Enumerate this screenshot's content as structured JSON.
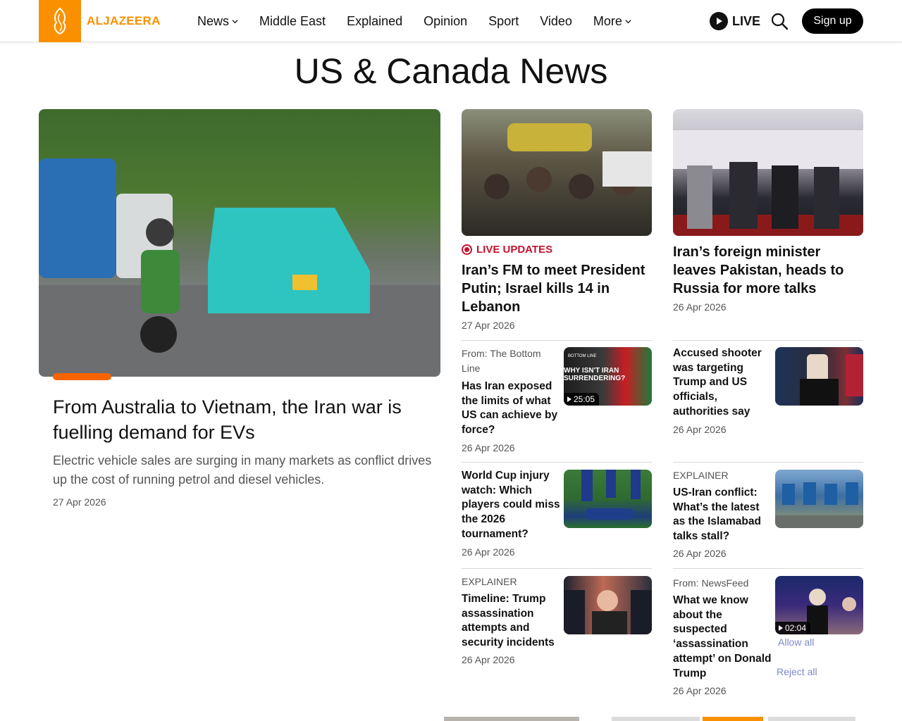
{
  "brand": {
    "logo_text": "ALJAZEERA",
    "accent_color": "#fa9000",
    "live_color": "#c4122f"
  },
  "nav": {
    "items": [
      {
        "label": "News",
        "has_dropdown": true
      },
      {
        "label": "Middle East",
        "has_dropdown": false
      },
      {
        "label": "Explained",
        "has_dropdown": false
      },
      {
        "label": "Opinion",
        "has_dropdown": false
      },
      {
        "label": "Sport",
        "has_dropdown": false
      },
      {
        "label": "Video",
        "has_dropdown": false
      },
      {
        "label": "More",
        "has_dropdown": true
      }
    ],
    "live_label": "LIVE",
    "signup_label": "Sign up"
  },
  "page": {
    "title": "US & Canada News"
  },
  "hero": {
    "title": "From Australia to Vietnam, the Iran war is fuelling demand for EVs",
    "description": "Electric vehicle sales are surging in many markets as conflict drives up the cost of running petrol and diesel vehicles.",
    "date": "27 Apr 2026"
  },
  "top_cards": [
    {
      "tag": "LIVE UPDATES",
      "title": "Iran’s FM to meet President Putin; Israel kills 14 in Lebanon",
      "date": "27 Apr 2026"
    },
    {
      "title": "Iran’s foreign minister leaves Pakistan, heads to Russia for more talks",
      "date": "26 Apr 2026"
    }
  ],
  "list_cards": [
    {
      "kicker": "From: The Bottom Line",
      "title": "Has Iran exposed the limits of what US can achieve by force?",
      "date": "26 Apr 2026",
      "duration": "25:05",
      "thumb_text": "WHY ISN'T IRAN SURRENDERING?",
      "thumb_badge": "BOTTOM LINE"
    },
    {
      "title": "Accused shooter was targeting Trump and US officials, authorities say",
      "date": "26 Apr 2026"
    },
    {
      "title": "World Cup injury watch: Which players could miss the 2026 tournament?",
      "date": "26 Apr 2026"
    },
    {
      "kicker": "EXPLAINER",
      "title": "US-Iran conflict: What’s the latest as the Islamabad talks stall?",
      "date": "26 Apr 2026"
    },
    {
      "kicker": "EXPLAINER",
      "title": "Timeline: Trump assassination attempts and security incidents",
      "date": "26 Apr 2026"
    },
    {
      "kicker": "From: NewsFeed",
      "title": "What we know about the suspected ‘assassination attempt’ on Donald Trump",
      "date": "26 Apr 2026",
      "duration": "02:04"
    }
  ],
  "cookie": {
    "allow_label": "Allow all",
    "reject_label": "Reject all"
  }
}
